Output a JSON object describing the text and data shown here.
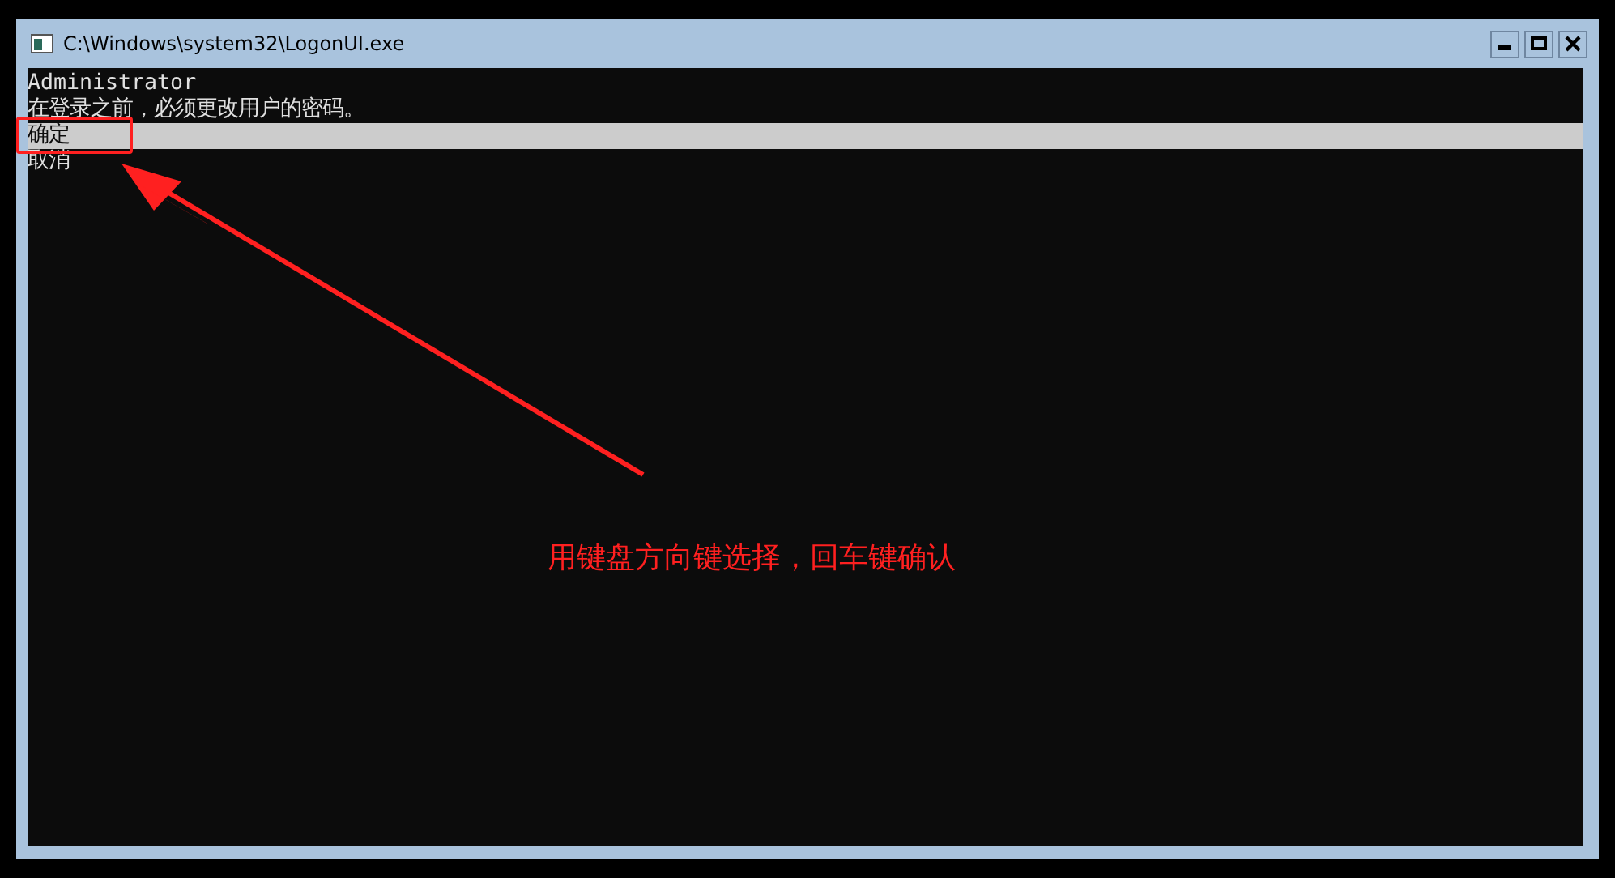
{
  "window": {
    "title": "C:\\Windows\\system32\\LogonUI.exe"
  },
  "console": {
    "lines": [
      "Administrator",
      "在登录之前，必须更改用户的密码。"
    ],
    "options": [
      {
        "label": "确定",
        "selected": true
      },
      {
        "label": "取消",
        "selected": false
      }
    ]
  },
  "annotation": {
    "text": "用键盘方向键选择，回车键确认"
  }
}
